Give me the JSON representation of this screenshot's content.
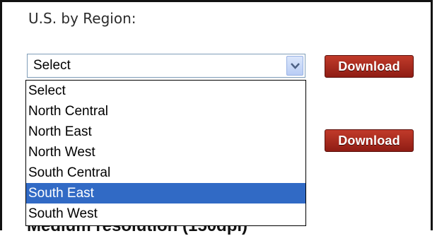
{
  "section": {
    "heading": "U.S. by Region:"
  },
  "region_select": {
    "value": "Select",
    "options": [
      "Select",
      "North Central",
      "North East",
      "North West",
      "South Central",
      "South East",
      "South West"
    ],
    "highlighted": "South East"
  },
  "buttons": {
    "download_1": "Download",
    "download_2": "Download"
  },
  "partial_text": "Medium resolution (150dpi)"
}
